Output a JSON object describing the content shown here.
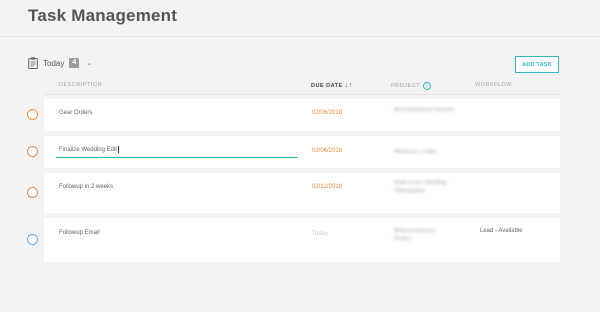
{
  "page": {
    "title": "Task Management"
  },
  "filter": {
    "label": "Today",
    "count": "4"
  },
  "toolbar": {
    "add_task_label": "ADD TASK"
  },
  "columns": {
    "description": "DESCRIPTION",
    "due_date": "DUE DATE",
    "project": "PROJECT",
    "workflow": "WORKFLOW"
  },
  "tasks": [
    {
      "description": "Gear Orders",
      "due": "02/06/2018",
      "project": "Mi Entrepreneur Summit",
      "workflow": "",
      "status": "overdue"
    },
    {
      "description": "Finalize Wedding Edit",
      "due": "02/06/2018",
      "project": "Marianne + Fabio",
      "workflow": "",
      "status": "overdue"
    },
    {
      "description": "Followup in 2 weeks",
      "due": "02/12/2018",
      "project": "Kristi Cruz's Wedding Videography",
      "workflow": "",
      "status": "overdue"
    },
    {
      "description": "Followup Email",
      "due": "Today",
      "project": "Melissa Harvey's Project",
      "workflow": "Lead - Available",
      "status": "today"
    }
  ],
  "colors": {
    "accent": "#34b7c2",
    "overdue": "#e58b3b",
    "today_circle": "#4fb6d8"
  }
}
